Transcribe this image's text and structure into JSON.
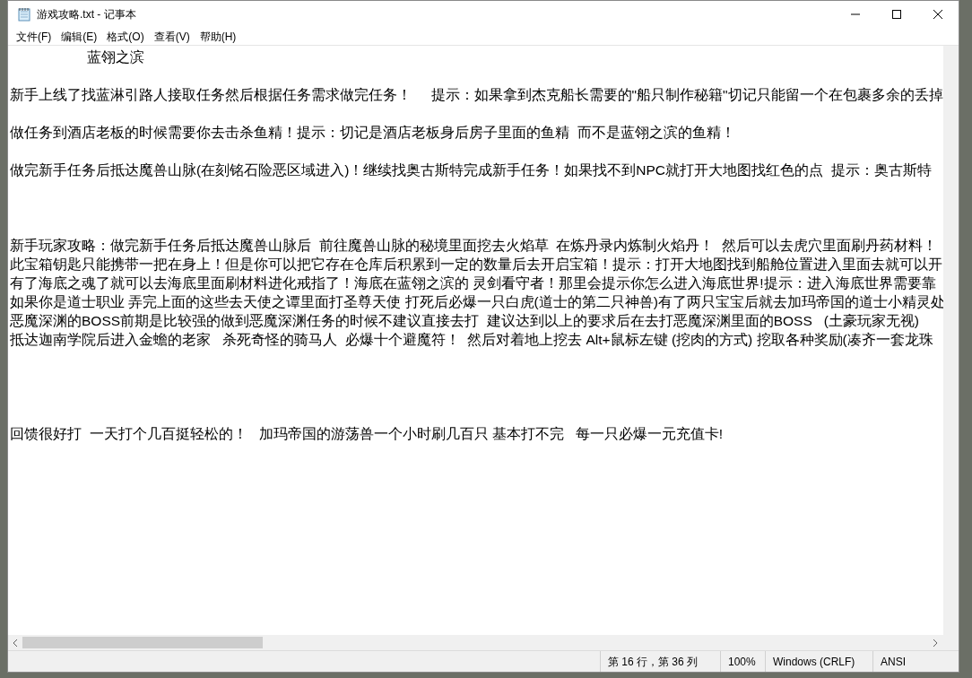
{
  "window": {
    "title": "游戏攻略.txt - 记事本"
  },
  "menu": [
    "文件(F)",
    "编辑(E)",
    "格式(O)",
    "查看(V)",
    "帮助(H)"
  ],
  "editor": {
    "lines": [
      {
        "kind": "text",
        "text": "                    蓝翎之滨"
      },
      {
        "kind": "blank"
      },
      {
        "kind": "text",
        "text": "新手上线了找蓝淋引路人接取任务然后根据任务需求做完任务！     提示：如果拿到杰克船长需要的\"船只制作秘籍\"切记只能留一个在包裹多余的丢掉"
      },
      {
        "kind": "blank"
      },
      {
        "kind": "text",
        "text": "做任务到酒店老板的时候需要你去击杀鱼精！提示：切记是酒店老板身后房子里面的鱼精  而不是蓝翎之滨的鱼精！"
      },
      {
        "kind": "blank"
      },
      {
        "kind": "text",
        "text": "做完新手任务后抵达魔兽山脉(在刻铭石险恶区域进入)！继续找奥古斯特完成新手任务！如果找不到NPC就打开大地图找红色的点  提示：奥古斯特"
      },
      {
        "kind": "blank"
      },
      {
        "kind": "blank"
      },
      {
        "kind": "blank"
      },
      {
        "kind": "text",
        "text": "新手玩家攻略：做完新手任务后抵达魔兽山脉后  前往魔兽山脉的秘境里面挖去火焰草  在炼丹录内炼制火焰丹！  然后可以去虎穴里面刷丹药材料！"
      },
      {
        "kind": "text",
        "text": "此宝箱钥匙只能携带一把在身上！但是你可以把它存在仓库后积累到一定的数量后去开启宝箱！提示：打开大地图找到船舱位置进入里面去就可以开"
      },
      {
        "kind": "text",
        "text": "有了海底之魂了就可以去海底里面刷材料进化戒指了！海底在蓝翎之滨的 灵剑看守者！那里会提示你怎么进入海底世界!提示：进入海底世界需要靠"
      },
      {
        "kind": "text",
        "text": "如果你是道士职业 弄完上面的这些去天使之谭里面打圣尊天使 打死后必爆一只白虎(道士的第二只神兽)有了两只宝宝后就去加玛帝国的道士小精灵处"
      },
      {
        "kind": "text",
        "text": "恶魔深渊的BOSS前期是比较强的做到恶魔深渊任务的时候不建议直接去打  建议达到以上的要求后在去打恶魔深渊里面的BOSS   (土豪玩家无视)"
      },
      {
        "kind": "text",
        "text": "抵达迦南学院后进入金蟾的老家   杀死奇怪的骑马人  必爆十个避魔符！  然后对着地上挖去 Alt+鼠标左键 (挖肉的方式) 挖取各种奖励(凑齐一套龙珠"
      },
      {
        "kind": "blank"
      },
      {
        "kind": "blank"
      },
      {
        "kind": "blank"
      },
      {
        "kind": "blank"
      },
      {
        "kind": "text",
        "text": "回馈很好打  一天打个几百挺轻松的！   加玛帝国的游荡兽一个小时刷几百只 基本打不完   每一只必爆一元充值卡!"
      }
    ]
  },
  "status_bar": [
    "第 16 行，第 36 列",
    "100%",
    "Windows (CRLF)",
    "ANSI"
  ]
}
